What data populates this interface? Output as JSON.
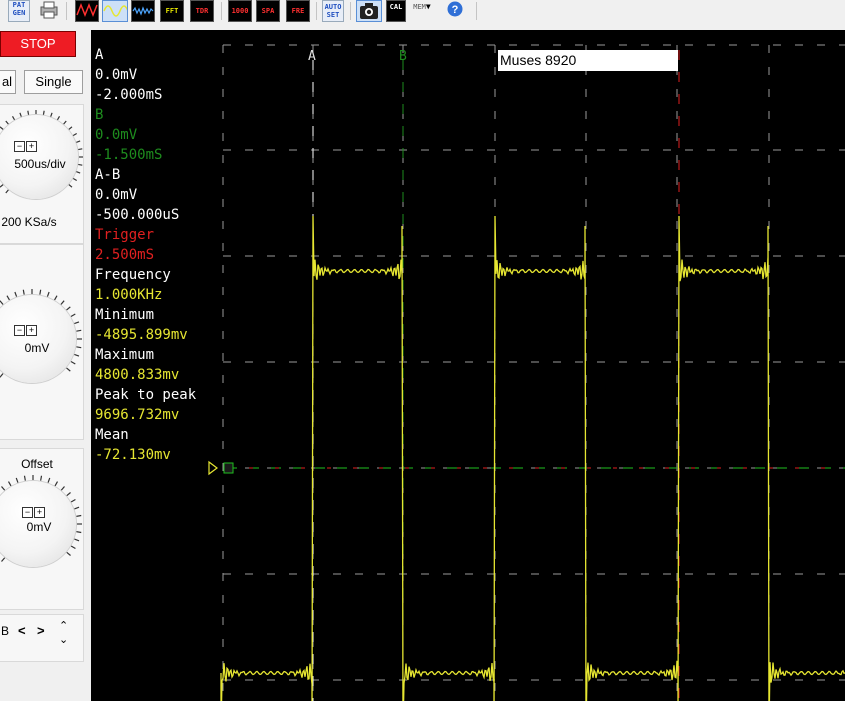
{
  "toolbar": {
    "buttons": [
      {
        "name": "pat-gen",
        "label": "PAT GEN"
      },
      {
        "name": "print",
        "label": ""
      },
      {
        "name": "waveform-1",
        "label": ""
      },
      {
        "name": "waveform-2",
        "label": ""
      },
      {
        "name": "waveform-3",
        "label": ""
      },
      {
        "name": "fft",
        "label": "FFT"
      },
      {
        "name": "tdr",
        "label": "TDR"
      },
      {
        "name": "meter",
        "label": "1000"
      },
      {
        "name": "spa",
        "label": "SPA"
      },
      {
        "name": "freq",
        "label": "FRE"
      },
      {
        "name": "auto-set",
        "label": "AUTO SET"
      },
      {
        "name": "camera",
        "label": ""
      },
      {
        "name": "calc",
        "label": "CAL"
      },
      {
        "name": "mem",
        "label": "MEM"
      },
      {
        "name": "help",
        "label": "?"
      }
    ]
  },
  "left": {
    "stop_label": "STOP",
    "normal_label": "al",
    "single_label": "Single",
    "timebase_label": "500us/div",
    "sample_rate": "200 KSa/s",
    "level_label": "0mV",
    "offset_title": "Offset",
    "offset_label": "0mV",
    "channel_label": "B"
  },
  "scope": {
    "title": "Muses 8920",
    "cursor_a_label": "A",
    "cursor_b_label": "B",
    "info": [
      {
        "text": "A",
        "color": "#ffffff"
      },
      {
        "text": "0.0mV",
        "color": "#ffffff"
      },
      {
        "text": "-2.000mS",
        "color": "#ffffff"
      },
      {
        "text": "B",
        "color": "#1e8c1e"
      },
      {
        "text": "0.0mV",
        "color": "#1e8c1e"
      },
      {
        "text": "-1.500mS",
        "color": "#1e8c1e"
      },
      {
        "text": "A-B",
        "color": "#ffffff"
      },
      {
        "text": "0.0mV",
        "color": "#ffffff"
      },
      {
        "text": "-500.000uS",
        "color": "#ffffff"
      },
      {
        "text": "Trigger",
        "color": "#e02020"
      },
      {
        "text": "2.500mS",
        "color": "#e02020"
      },
      {
        "text": "Frequency",
        "color": "#ffffff"
      },
      {
        "text": "1.000KHz",
        "color": "#e6e632"
      },
      {
        "text": "Minimum",
        "color": "#ffffff"
      },
      {
        "text": "-4895.899mv",
        "color": "#e6e632"
      },
      {
        "text": "Maximum",
        "color": "#ffffff"
      },
      {
        "text": "4800.833mv",
        "color": "#e6e632"
      },
      {
        "text": "Peak to peak",
        "color": "#ffffff"
      },
      {
        "text": "9696.732mv",
        "color": "#e6e632"
      },
      {
        "text": "Mean",
        "color": "#ffffff"
      },
      {
        "text": "-72.130mv",
        "color": "#e6e632"
      }
    ],
    "colors": {
      "trace": "#e6e632",
      "cursor_a": "#ffffff",
      "cursor_b": "#1e8c1e",
      "trigger": "#e02020",
      "grid": "#9a9a9a",
      "ground": "#20c020"
    }
  }
}
